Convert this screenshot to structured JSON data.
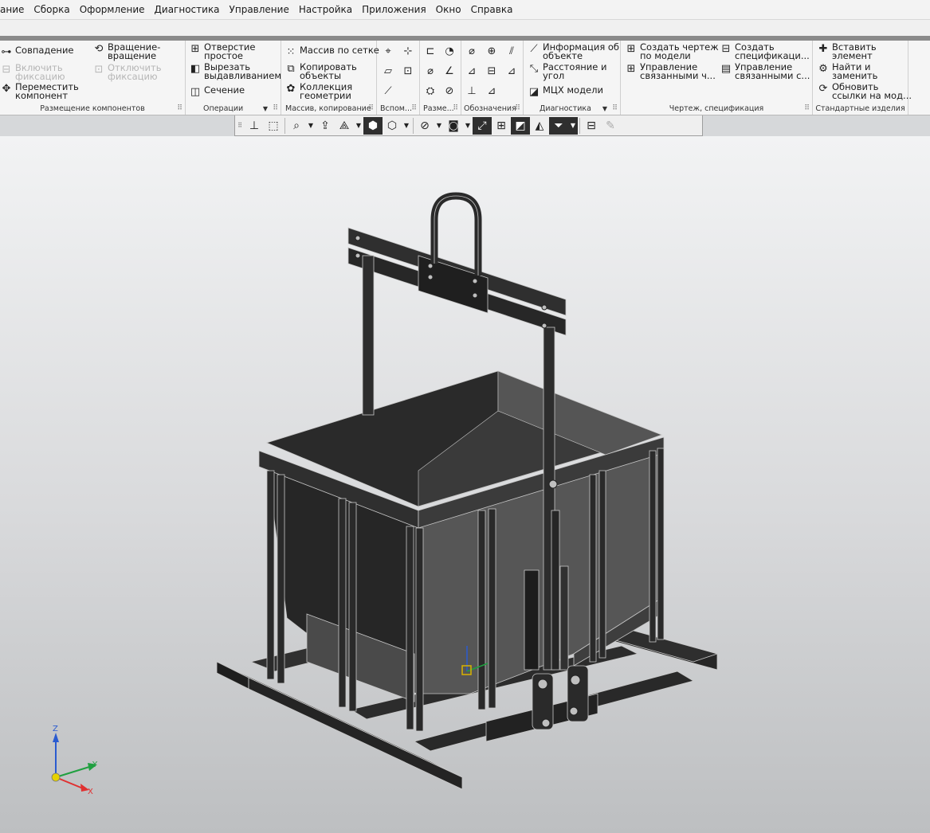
{
  "menu": [
    "ание",
    "Сборка",
    "Оформление",
    "Диагностика",
    "Управление",
    "Настройка",
    "Приложения",
    "Окно",
    "Справка"
  ],
  "ribbon": {
    "placement": {
      "label": "Размещение компонентов",
      "coincidence": "Совпадение",
      "rotate_move": "Вращение-\nвращение",
      "fix_on": "Включить\nфиксацию",
      "fix_off": "Отключить\nфиксацию",
      "move_component": "Переместить\nкомпонент"
    },
    "operations": {
      "label": "Операции",
      "simple_hole": "Отверстие\nпростое",
      "extrude_cut": "Вырезать\nвыдавливанием",
      "section": "Сечение"
    },
    "array": {
      "label": "Массив, копирование",
      "grid_array": "Массив по сетке",
      "copy_objects": "Копировать\nобъекты",
      "geometry_collection": "Коллекция\nгеометрии"
    },
    "aux": {
      "label": "Вспом..."
    },
    "dims": {
      "label": "Разме..."
    },
    "designations": {
      "label": "Обозначения"
    },
    "diagnostics": {
      "label": "Диагностика",
      "object_info": "Информация об\nобъекте",
      "distance_angle": "Расстояние и\nугол",
      "mass_props": "МЦХ модели"
    },
    "drawing": {
      "label": "Чертеж, спецификация",
      "create_drawing": "Создать чертеж\nпо модели",
      "create_spec": "Создать\nспецификаци...",
      "manage_linked_drawings": "Управление\nсвязанными ч...",
      "manage_linked_specs": "Управление\nсвязанными с..."
    },
    "standard": {
      "label": "Стандартные изделия",
      "insert": "Вставить\nэлемент",
      "find_replace": "Найти и\nзаменить",
      "refresh_links": "Обновить\nссылки на мод..."
    }
  },
  "triad": {
    "z": "Z",
    "y": "Y",
    "x": "X"
  },
  "colors": {
    "viewport_top": "#f2f3f4",
    "viewport_bottom": "#bdbfc1",
    "model_dark": "#2b2b2b",
    "model_edge": "#c8c8c8",
    "axis_x": "#e03030",
    "axis_y": "#20a040",
    "axis_z": "#2a5bd0"
  }
}
